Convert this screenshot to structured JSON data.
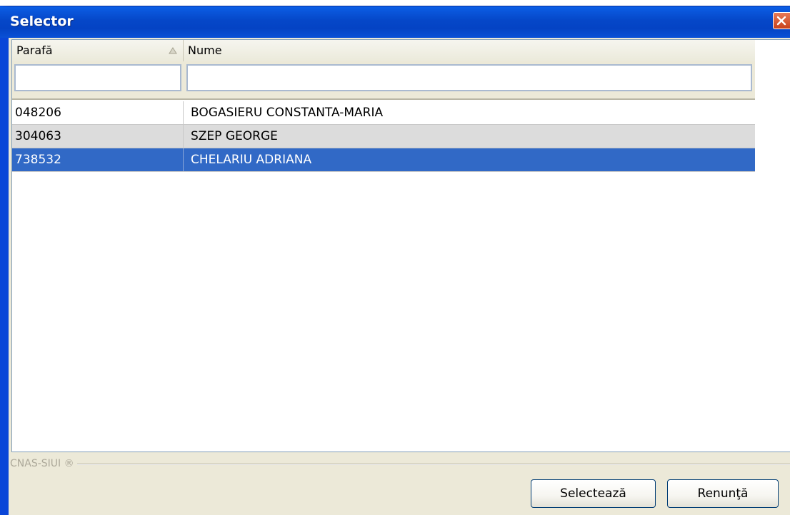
{
  "window": {
    "title": "Selector"
  },
  "grid": {
    "columns": [
      {
        "label": "Parafă",
        "sort": "ascending"
      },
      {
        "label": "Nume"
      }
    ],
    "filters": [
      "",
      ""
    ],
    "rows": [
      {
        "parafa": "048206",
        "nume": "BOGASIERU CONSTANTA-MARIA",
        "selected": false
      },
      {
        "parafa": "304063",
        "nume": "SZEP GEORGE",
        "selected": false
      },
      {
        "parafa": "738532",
        "nume": "CHELARIU ADRIANA",
        "selected": true
      }
    ]
  },
  "footer": {
    "group_label": "CNAS-SIUI ®"
  },
  "buttons": {
    "select": "Selectează",
    "cancel": "Renunţă"
  },
  "colors": {
    "titlebar": "#0547c8",
    "selection": "#3169c6",
    "alt_row": "#dcdcdc"
  },
  "icons": {
    "close": "close-icon",
    "sort": "sort-ascending-icon"
  }
}
